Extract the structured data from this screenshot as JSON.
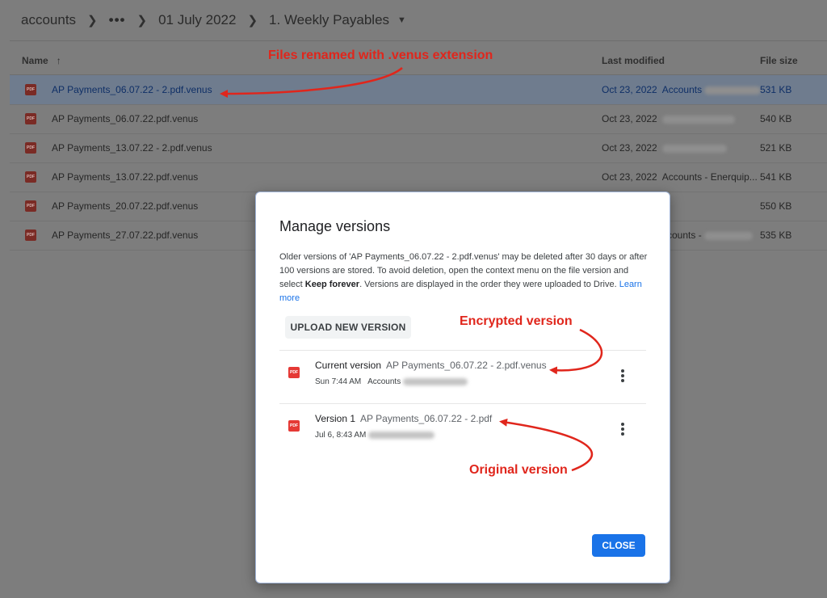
{
  "breadcrumb": {
    "items": [
      "accounts",
      "•••",
      "01 July 2022",
      "1. Weekly Payables"
    ]
  },
  "file_list": {
    "headers": {
      "name": "Name",
      "last_modified": "Last modified",
      "file_size": "File size"
    },
    "rows": [
      {
        "name": "AP Payments_06.07.22 - 2.pdf.venus",
        "modified": "Oct 23, 2022",
        "owner": "Accounts",
        "size": "531 KB",
        "selected": true
      },
      {
        "name": "AP Payments_06.07.22.pdf.venus",
        "modified": "Oct 23, 2022",
        "owner": "",
        "size": "540 KB",
        "selected": false
      },
      {
        "name": "AP Payments_13.07.22 - 2.pdf.venus",
        "modified": "Oct 23, 2022",
        "owner": "",
        "size": "521 KB",
        "selected": false
      },
      {
        "name": "AP Payments_13.07.22.pdf.venus",
        "modified": "Oct 23, 2022",
        "owner": "Accounts - Enerquip...",
        "size": "541 KB",
        "selected": false
      },
      {
        "name": "AP Payments_20.07.22.pdf.venus",
        "modified": "",
        "owner": "",
        "size": "550 KB",
        "selected": false
      },
      {
        "name": "AP Payments_27.07.22.pdf.venus",
        "modified": "",
        "owner": "ccounts -",
        "size": "535 KB",
        "selected": false
      }
    ],
    "pdf_badge": "PDF"
  },
  "annotations": {
    "renamed": "Files renamed with .venus extension",
    "encrypted": "Encrypted version",
    "original": "Original version"
  },
  "modal": {
    "title": "Manage versions",
    "desc_part1": "Older versions of 'AP Payments_06.07.22 - 2.pdf.venus' may be deleted after 30 days or after 100 versions are stored. To avoid deletion, open the context menu on the file version and select ",
    "desc_bold": "Keep forever",
    "desc_part2": ". Versions are displayed in the order they were uploaded to Drive. ",
    "learn_more": "Learn more",
    "upload_label": "UPLOAD NEW VERSION",
    "versions": [
      {
        "label": "Current version",
        "file": "AP Payments_06.07.22 - 2.pdf.venus",
        "time": "Sun 7:44 AM",
        "user": "Accounts"
      },
      {
        "label": "Version 1",
        "file": "AP Payments_06.07.22 - 2.pdf",
        "time": "Jul 6, 8:43 AM",
        "user": ""
      }
    ],
    "close_label": "CLOSE"
  },
  "colors": {
    "accent": "#1a73e8",
    "annotation": "#e0261c",
    "pdf_icon": "#e53935"
  }
}
